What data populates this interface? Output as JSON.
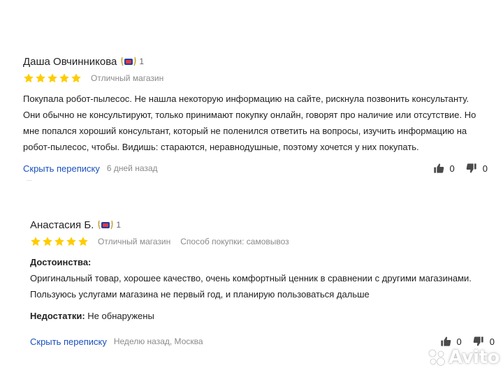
{
  "reviews": [
    {
      "author": "Даша Овчинникова",
      "badge_count": "1",
      "rating": 5,
      "shop_rating_text": "Отличный магазин",
      "text": "Покупала робот-пылесос. Не нашла некоторую информацию на сайте, рискнула позвонить консультанту. Они обычно не консультируют, только принимают покупку онлайн, говорят про наличие или отсутствие. Но мне попался хороший консультант, который не поленился ответить на вопросы, изучить информацию на робот-пылесос, чтобы. Видишь: стараются, неравнодушные, поэтому хочется у них покупать.",
      "reply_link": "Скрыть переписку",
      "date": "6 дней назад",
      "likes": "0",
      "dislikes": "0"
    },
    {
      "author": "Анастасия Б.",
      "badge_count": "1",
      "rating": 5,
      "shop_rating_text": "Отличный магазин",
      "purchase_method": "Способ покупки: самовывоз",
      "pros_label": "Достоинства:",
      "pros_text": "Оригинальный товар, хорошее качество, очень комфортный ценник в сравнении с другими магазинами. Пользуюсь услугами магазина не первый год, и планирую пользоваться дальше",
      "cons_label": "Недостатки:",
      "cons_text": "Не обнаружены",
      "reply_link": "Скрыть переписку",
      "date": "Неделю назад, Москва",
      "likes": "0",
      "dislikes": "0"
    }
  ],
  "watermark": "Avito",
  "colors": {
    "star": "#ffcc00",
    "link": "#1a4fbd",
    "muted": "#8a8a8a"
  }
}
